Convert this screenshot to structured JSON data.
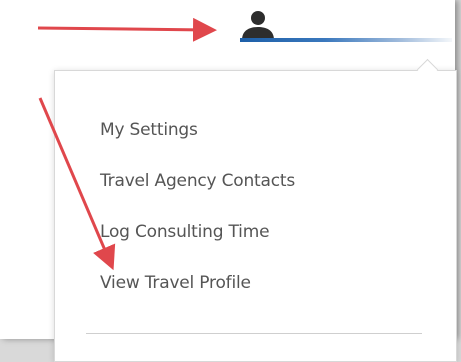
{
  "header": {
    "user_icon": "user-icon",
    "accent_color": "#1d5fa8"
  },
  "menu": {
    "items": [
      {
        "label": "My Settings"
      },
      {
        "label": "Travel Agency Contacts"
      },
      {
        "label": "Log Consulting Time"
      },
      {
        "label": "View Travel Profile"
      }
    ]
  },
  "annotations": {
    "arrow_color": "#e0474c"
  }
}
